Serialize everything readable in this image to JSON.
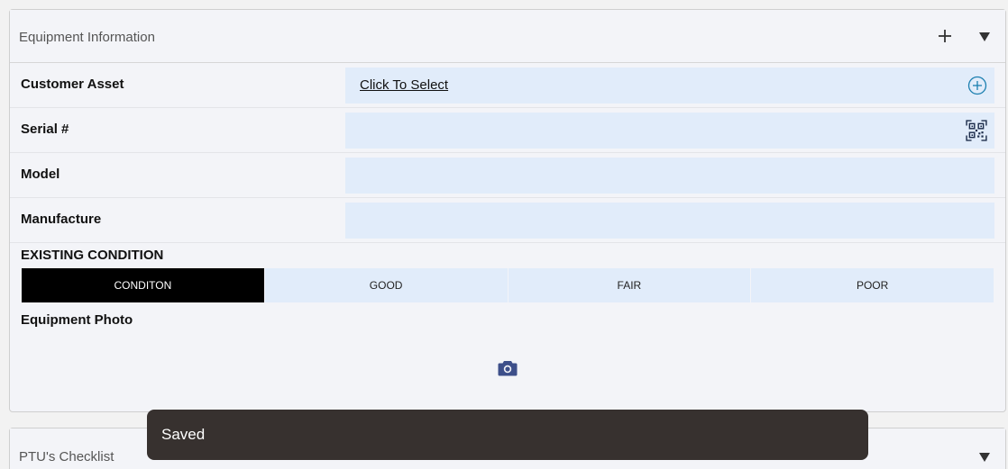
{
  "equipment_panel": {
    "title": "Equipment Information",
    "fields": [
      {
        "label": "Customer Asset",
        "value": "Click To Select",
        "icon": "add-circle-icon"
      },
      {
        "label": "Serial #",
        "value": "",
        "icon": "qr-code-icon"
      },
      {
        "label": "Model",
        "value": ""
      },
      {
        "label": "Manufacture",
        "value": ""
      }
    ],
    "existing_condition": {
      "label": "EXISTING CONDITION",
      "options": [
        "CONDITON",
        "GOOD",
        "FAIR",
        "POOR"
      ],
      "selected": "CONDITON"
    },
    "photo": {
      "label": "Equipment Photo",
      "icon": "camera-icon"
    }
  },
  "ptu_panel": {
    "title": "PTU's Checklist"
  },
  "toast": {
    "message": "Saved"
  },
  "colors": {
    "field_bg": "#e1ecfa",
    "accent": "#1b7fb0",
    "selected_segment": "#000000",
    "toast_bg": "#37312f"
  }
}
